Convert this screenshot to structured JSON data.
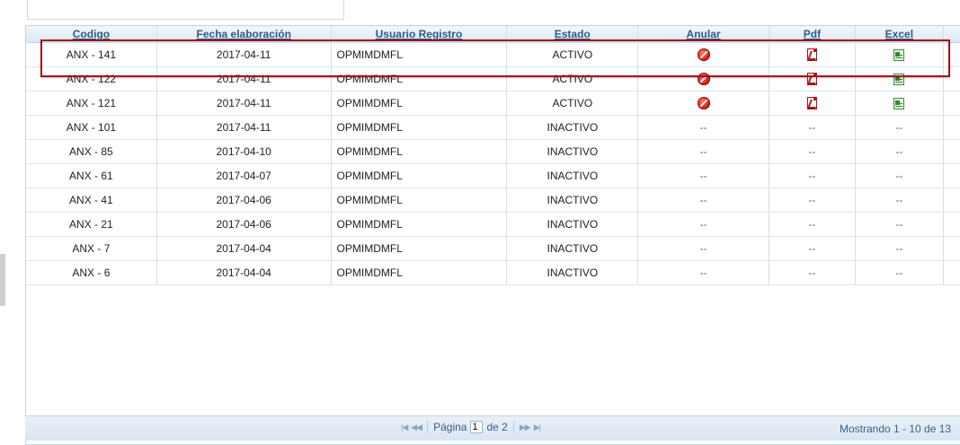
{
  "columns": [
    "Codigo",
    "Fecha elaboración",
    "Usuario Registro",
    "Estado",
    "Anular",
    "Pdf",
    "Excel"
  ],
  "rows": [
    {
      "codigo": "ANX - 141",
      "fecha": "2017-04-11",
      "usuario": "OPMIMDMFL",
      "estado": "ACTIVO",
      "actions": true
    },
    {
      "codigo": "ANX - 122",
      "fecha": "2017-04-11",
      "usuario": "OPMIMDMFL",
      "estado": "ACTIVO",
      "actions": true
    },
    {
      "codigo": "ANX - 121",
      "fecha": "2017-04-11",
      "usuario": "OPMIMDMFL",
      "estado": "ACTIVO",
      "actions": true
    },
    {
      "codigo": "ANX - 101",
      "fecha": "2017-04-11",
      "usuario": "OPMIMDMFL",
      "estado": "INACTIVO",
      "actions": false
    },
    {
      "codigo": "ANX - 85",
      "fecha": "2017-04-10",
      "usuario": "OPMIMDMFL",
      "estado": "INACTIVO",
      "actions": false
    },
    {
      "codigo": "ANX - 61",
      "fecha": "2017-04-07",
      "usuario": "OPMIMDMFL",
      "estado": "INACTIVO",
      "actions": false
    },
    {
      "codigo": "ANX - 41",
      "fecha": "2017-04-06",
      "usuario": "OPMIMDMFL",
      "estado": "INACTIVO",
      "actions": false
    },
    {
      "codigo": "ANX - 21",
      "fecha": "2017-04-06",
      "usuario": "OPMIMDMFL",
      "estado": "INACTIVO",
      "actions": false
    },
    {
      "codigo": "ANX - 7",
      "fecha": "2017-04-04",
      "usuario": "OPMIMDMFL",
      "estado": "INACTIVO",
      "actions": false
    },
    {
      "codigo": "ANX - 6",
      "fecha": "2017-04-04",
      "usuario": "OPMIMDMFL",
      "estado": "INACTIVO",
      "actions": false
    }
  ],
  "empty_action": "--",
  "icons": {
    "anular": "cancel-circle-icon",
    "pdf": "pdf-file-icon",
    "excel": "excel-file-icon"
  },
  "pager": {
    "page_label": "Página",
    "current_page": "1",
    "of_label": "de 2",
    "status": "Mostrando 1 - 10 de 13",
    "first_glyph": "|◀",
    "prev_glyph": "◀◀",
    "next_glyph": "▶▶",
    "last_glyph": "▶|"
  },
  "colors": {
    "header_text": "#2d5a8b",
    "highlight": "#a21416"
  }
}
